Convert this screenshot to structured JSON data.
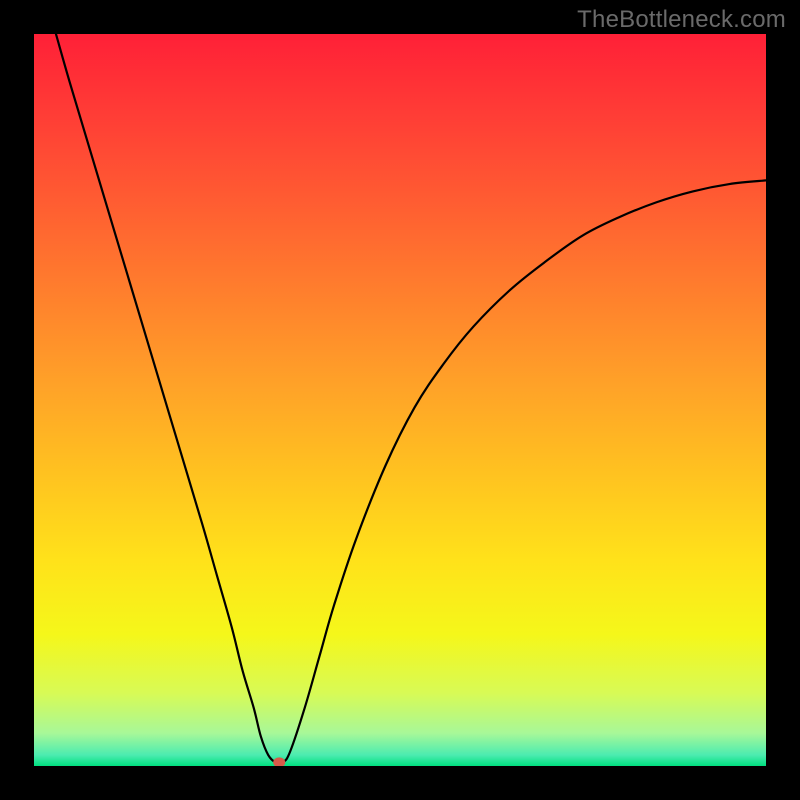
{
  "watermark": "TheBottleneck.com",
  "chart_data": {
    "type": "line",
    "title": "",
    "xlabel": "",
    "ylabel": "",
    "xlim": [
      0,
      100
    ],
    "ylim": [
      0,
      100
    ],
    "grid": false,
    "series": [
      {
        "name": "curve",
        "x": [
          3,
          5,
          8,
          11,
          14,
          17,
          20,
          23,
          25,
          27,
          28.5,
          30,
          31,
          32,
          33,
          34,
          35,
          37,
          39,
          41,
          44,
          48,
          52,
          56,
          60,
          65,
          70,
          75,
          80,
          85,
          90,
          95,
          100
        ],
        "y": [
          100,
          93,
          83,
          73,
          63,
          53,
          43,
          33,
          26,
          19,
          13,
          8,
          4,
          1.5,
          0.5,
          0.5,
          2,
          8,
          15,
          22,
          31,
          41,
          49,
          55,
          60,
          65,
          69,
          72.5,
          75,
          77,
          78.5,
          79.5,
          80
        ]
      }
    ],
    "marker": {
      "x": 33.5,
      "y": 0.5,
      "color": "#d85a4a"
    },
    "background_gradient": {
      "stops": [
        {
          "offset": 0.0,
          "color": "#ff2037"
        },
        {
          "offset": 0.1,
          "color": "#ff3a36"
        },
        {
          "offset": 0.22,
          "color": "#ff5a32"
        },
        {
          "offset": 0.35,
          "color": "#ff7e2d"
        },
        {
          "offset": 0.48,
          "color": "#ffa228"
        },
        {
          "offset": 0.6,
          "color": "#ffc220"
        },
        {
          "offset": 0.72,
          "color": "#ffe21a"
        },
        {
          "offset": 0.82,
          "color": "#f5f71a"
        },
        {
          "offset": 0.9,
          "color": "#d8fa55"
        },
        {
          "offset": 0.955,
          "color": "#a8f898"
        },
        {
          "offset": 0.985,
          "color": "#4cecb0"
        },
        {
          "offset": 1.0,
          "color": "#00e080"
        }
      ]
    }
  }
}
